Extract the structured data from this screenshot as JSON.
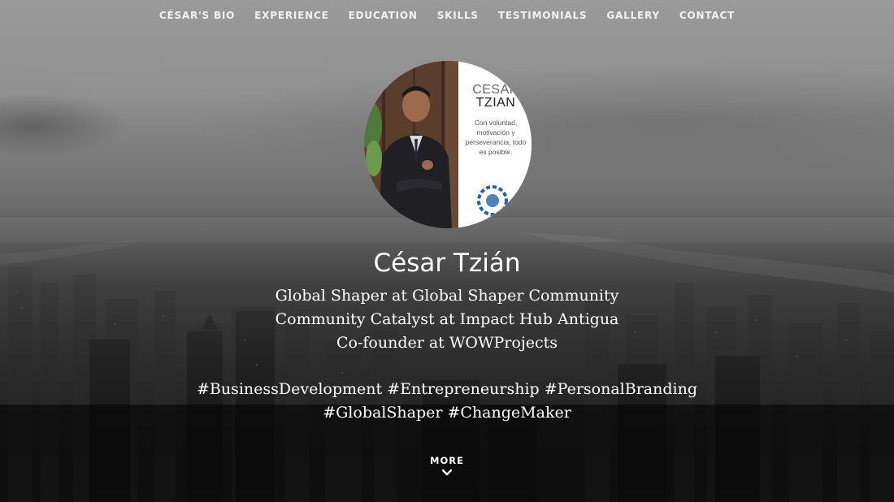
{
  "nav": {
    "items": [
      {
        "label": "CÉSAR'S BIO"
      },
      {
        "label": "EXPERIENCE"
      },
      {
        "label": "EDUCATION"
      },
      {
        "label": "SKILLS"
      },
      {
        "label": "TESTIMONIALS"
      },
      {
        "label": "GALLERY"
      },
      {
        "label": "CONTACT"
      }
    ]
  },
  "profile": {
    "photo_card": {
      "first_name": "CESAR",
      "last_name": "TZIAN",
      "motto": "Con voluntad, motivación y perseverancia, todo es posible."
    },
    "name": "César Tzián",
    "roles": [
      "Global Shaper at Global Shaper Community",
      "Community Catalyst at Impact Hub Antigua",
      "Co-founder at WOWProjects"
    ],
    "hashtags": [
      "#BusinessDevelopment #Entrepreneurship #PersonalBranding",
      "#GlobalShaper #ChangeMaker"
    ]
  },
  "more": {
    "label": "MORE",
    "icon": "chevron-down-icon"
  },
  "colors": {
    "text": "#ffffff",
    "sky": "#9a9a9a",
    "city_dark": "#0a0a0a"
  }
}
